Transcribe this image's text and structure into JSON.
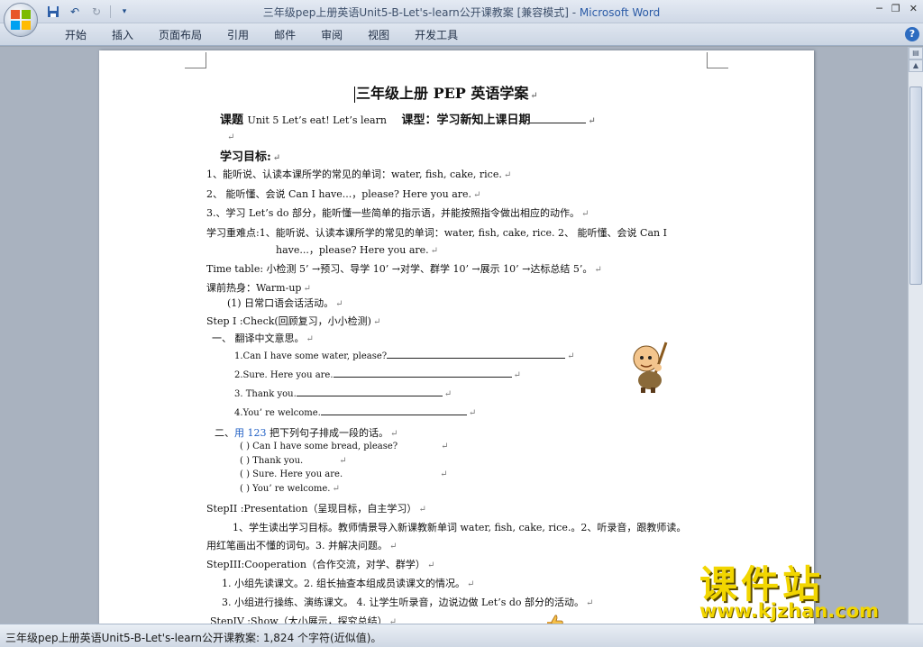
{
  "window": {
    "doc_title": "三年级pep上册英语Unit5-B-Let's-learn公开课教案 [兼容模式] - ",
    "app_name": "Microsoft Word"
  },
  "ribbon": {
    "tabs": [
      "开始",
      "插入",
      "页面布局",
      "引用",
      "邮件",
      "审阅",
      "视图",
      "开发工具"
    ],
    "help_label": "?"
  },
  "document": {
    "title": "三年级上册 PEP 英语学案",
    "lesson_label": "课题",
    "lesson_text": "Unit 5 Let’s eat! Let’s learn",
    "type_label": "课型：学习新知上课日期",
    "goals_heading": "学习目标:",
    "goal1": "1、能听说、认读本课所学的常见的单词：water, fish, cake, rice.",
    "goal2": "2、 能听懂、会说 Can I have...，please? Here you are.",
    "goal3": "3.、学习 Let’s do 部分，能听懂一些简单的指示语，并能按照指令做出相应的动作。",
    "key_points_1": "学习重难点:1、能听说、认读本课所学的常见的单词：water, fish, cake, rice. 2、 能听懂、会说 Can I",
    "key_points_2": "have...，please? Here you are.",
    "timetable": "Time table:  小检测 5’ →预习、导学 10’ →对学、群学 10’ →展示 10’ →达标总结 5’。",
    "warmup": "课前热身：Warm-up",
    "warmup_1": "(1) 日常口语会话活动。",
    "step1": "Step I :Check(回顾复习，小小检测)",
    "sec1": "一、 翻译中文意思。",
    "q1": "1.Can I have some water, please?",
    "q2": "2.Sure. Here you are.",
    "q3": "3. Thank you.",
    "q4": "4.You’ re welcome.",
    "sec2_prefix": "二、",
    "sec2_blue": "用 123",
    "sec2_rest": "把下列句子排成一段的话。",
    "order_items": [
      "(    ) Can I have some bread, please?",
      "(    ) Thank you.",
      "(    ) Sure. Here you are.",
      "(    ) You’ re  welcome."
    ],
    "step2": "StepII :Presentation（呈现目标，自主学习）",
    "step2_body_1": "1、学生读出学习目标。教师情景导入新课教新单词 water, fish, cake, rice.。2、听录音，跟教师读。",
    "step2_body_2": "用红笔画出不懂的词句。3. 并解决问题。",
    "step3": "StepIII:Cooperation（合作交流，对学、群学）",
    "step3_body_1": "1. 小组先读课文。2. 组长抽查本组成员读课文的情况。",
    "step3_body_2": "3. 小组进行操练、演练课文。 4. 让学生听录音，边说边做 Let’s do 部分的活动。",
    "step4": "StepIV :Show（大小展示，探究总结）"
  },
  "watermark": {
    "text": "课件站",
    "url": "www.kjzhan.com"
  },
  "statusbar": {
    "text": "三年级pep上册英语Unit5-B-Let's-learn公开课教案: 1,824 个字符(近似值)。"
  }
}
